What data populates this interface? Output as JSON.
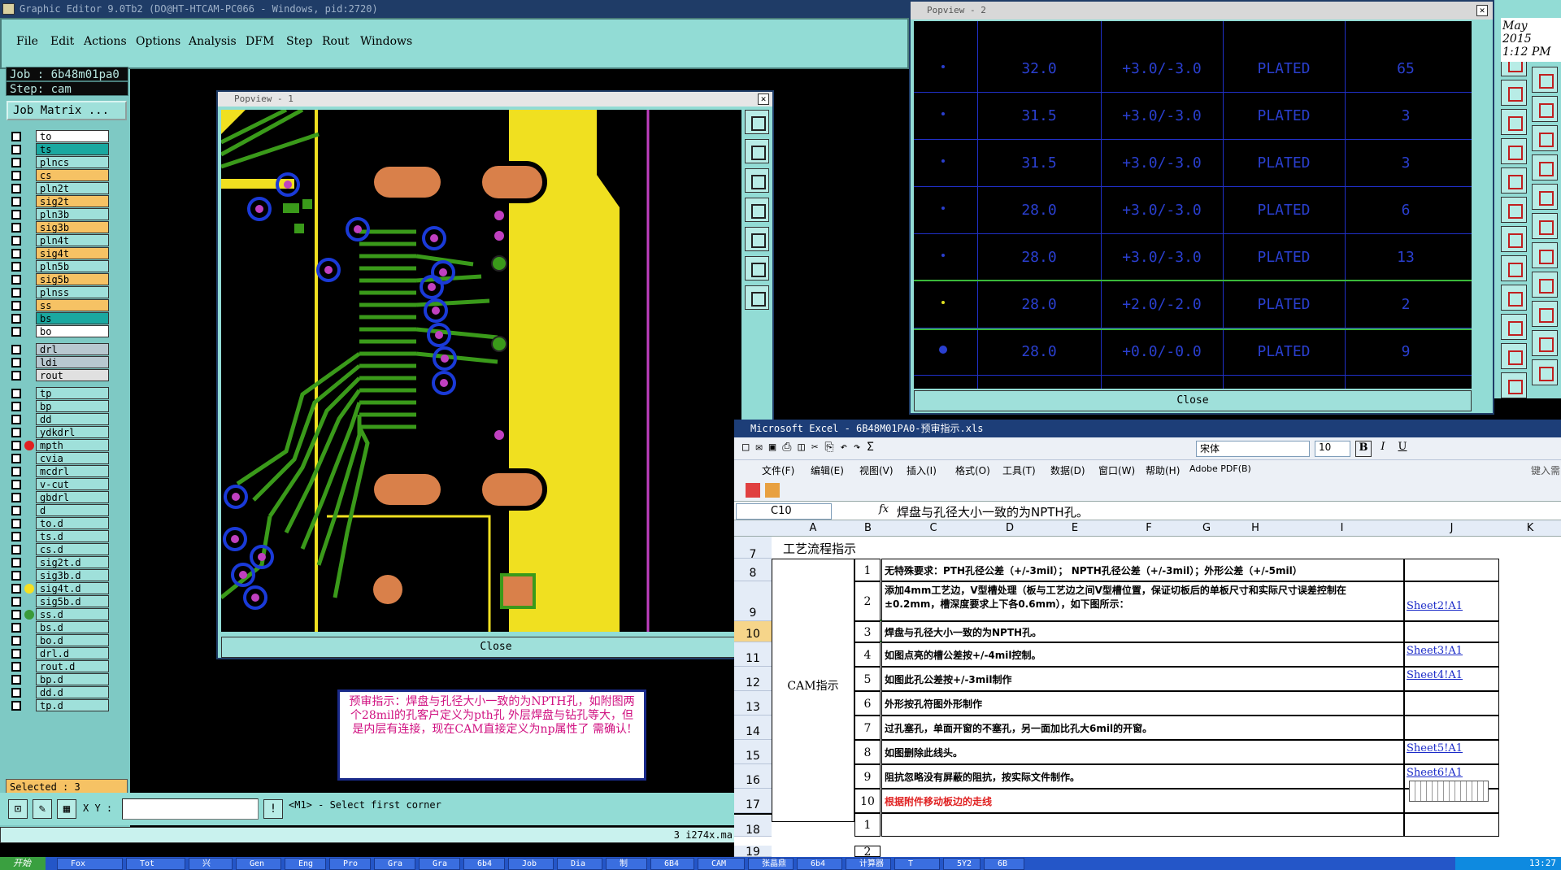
{
  "app": {
    "title": "Graphic Editor 9.0Tb2 (DO@HT-HTCAM-PC066 - Windows, pid:2720)",
    "menu": [
      "File",
      "Edit",
      "Actions",
      "Options",
      "Analysis",
      "DFM",
      "Step",
      "Rout",
      "Windows"
    ]
  },
  "job": {
    "job_label": "Job : 6b48m01pa0",
    "step_label": "Step: cam",
    "matrix_button": "Job Matrix ..."
  },
  "layers": [
    {
      "name": "to",
      "color": "#ffffff"
    },
    {
      "name": "ts",
      "color": "#1aa8a0"
    },
    {
      "name": "plncs",
      "color": "#9fe0da"
    },
    {
      "name": "cs",
      "color": "#f6c264"
    },
    {
      "name": "pln2t",
      "color": "#9fe0da"
    },
    {
      "name": "sig2t",
      "color": "#f6c264"
    },
    {
      "name": "pln3b",
      "color": "#9fe0da"
    },
    {
      "name": "sig3b",
      "color": "#f6c264"
    },
    {
      "name": "pln4t",
      "color": "#9fe0da"
    },
    {
      "name": "sig4t",
      "color": "#f6c264"
    },
    {
      "name": "pln5b",
      "color": "#9fe0da"
    },
    {
      "name": "sig5b",
      "color": "#f6c264"
    },
    {
      "name": "plnss",
      "color": "#9fe0da"
    },
    {
      "name": "ss",
      "color": "#f6c264"
    },
    {
      "name": "bs",
      "color": "#1aa8a0"
    },
    {
      "name": "bo",
      "color": "#ffffff"
    },
    {
      "name": "drl",
      "color": "#b8c8d0"
    },
    {
      "name": "ldi",
      "color": "#b8c8d0"
    },
    {
      "name": "rout",
      "color": "#e0e0e0"
    },
    {
      "name": "tp",
      "color": "#9fe0da"
    },
    {
      "name": "bp",
      "color": "#9fe0da"
    },
    {
      "name": "dd",
      "color": "#9fe0da"
    },
    {
      "name": "ydkdrl",
      "color": "#9fe0da"
    },
    {
      "name": "mpth",
      "color": "#9fe0da",
      "dot": "#e02020"
    },
    {
      "name": "cvia",
      "color": "#9fe0da"
    },
    {
      "name": "mcdrl",
      "color": "#9fe0da"
    },
    {
      "name": "v-cut",
      "color": "#9fe0da"
    },
    {
      "name": "gbdrl",
      "color": "#9fe0da"
    },
    {
      "name": "d",
      "color": "#9fe0da"
    },
    {
      "name": "to.d",
      "color": "#9fe0da"
    },
    {
      "name": "ts.d",
      "color": "#9fe0da"
    },
    {
      "name": "cs.d",
      "color": "#9fe0da"
    },
    {
      "name": "sig2t.d",
      "color": "#9fe0da"
    },
    {
      "name": "sig3b.d",
      "color": "#9fe0da"
    },
    {
      "name": "sig4t.d",
      "color": "#9fe0da",
      "dot": "#f6e020"
    },
    {
      "name": "sig5b.d",
      "color": "#9fe0da"
    },
    {
      "name": "ss.d",
      "color": "#9fe0da",
      "dot": "#3a9a3a"
    },
    {
      "name": "bs.d",
      "color": "#9fe0da"
    },
    {
      "name": "bo.d",
      "color": "#9fe0da"
    },
    {
      "name": "drl.d",
      "color": "#9fe0da"
    },
    {
      "name": "rout.d",
      "color": "#9fe0da"
    },
    {
      "name": "bp.d",
      "color": "#9fe0da"
    },
    {
      "name": "dd.d",
      "color": "#9fe0da"
    },
    {
      "name": "tp.d",
      "color": "#9fe0da"
    }
  ],
  "selected": "Selected : 3",
  "xy_label": "X Y :",
  "prompt": "<M1> - Select first corner",
  "status_right": "3 i274x.ma",
  "popview1": {
    "title": "Popview - 1",
    "close": "Close"
  },
  "popview2": {
    "title": "Popview - 2",
    "close": "Close",
    "rows": [
      {
        "size": "32.0",
        "tol": "+3.0/-3.0",
        "type": "PLATED",
        "count": "65"
      },
      {
        "size": "31.5",
        "tol": "+3.0/-3.0",
        "type": "PLATED",
        "count": "3"
      },
      {
        "size": "31.5",
        "tol": "+3.0/-3.0",
        "type": "PLATED",
        "count": "3"
      },
      {
        "size": "28.0",
        "tol": "+3.0/-3.0",
        "type": "PLATED",
        "count": "6"
      },
      {
        "size": "28.0",
        "tol": "+3.0/-3.0",
        "type": "PLATED",
        "count": "13"
      },
      {
        "size": "28.0",
        "tol": "+2.0/-2.0",
        "type": "PLATED",
        "count": "2"
      },
      {
        "size": "28.0",
        "tol": "+0.0/-0.0",
        "type": "PLATED",
        "count": "9"
      }
    ]
  },
  "clock": {
    "line1": "May 2015",
    "line2": "1:12 PM"
  },
  "precheck": "预审指示：焊盘与孔径大小一致的为NPTH孔，如附图两个28mil的孔客户定义为pth孔 外层焊盘与钻孔等大，但是内层有连接，现在CAM直接定义为np属性了 需确认!",
  "excel": {
    "title": "Microsoft Excel - 6B48M01PA0-预审指示.xls",
    "menu": [
      "文件(F)",
      "编辑(E)",
      "视图(V)",
      "插入(I)",
      "格式(O)",
      "工具(T)",
      "数据(D)",
      "窗口(W)",
      "帮助(H)",
      "Adobe PDF(B)"
    ],
    "font": "宋体",
    "font_size": "10",
    "help_hint": "键入需",
    "namebox": "C10",
    "formula": "焊盘与孔径大小一致的为NPTH孔。",
    "columns": [
      "A",
      "B",
      "C",
      "D",
      "E",
      "F",
      "G",
      "H",
      "I",
      "J",
      "K"
    ],
    "section_title": "工艺流程指示",
    "cam_label": "CAM指示",
    "rows": [
      {
        "rownum": "8",
        "num": "1",
        "text": "无特殊要求：PTH孔径公差（+/-3mil）；  NPTH孔径公差（+/-3mil）；外形公差（+/-5mil）",
        "link": ""
      },
      {
        "rownum": "9",
        "num": "2",
        "text": "添加4mm工艺边，V型槽处理（板与工艺边之间V型槽位置，保证切板后的单板尺寸和实际尺寸误差控制在±0.2mm，槽深度要求上下各0.6mm），如下图所示：",
        "link": "Sheet2!A1"
      },
      {
        "rownum": "10",
        "num": "3",
        "text": "焊盘与孔径大小一致的为NPTH孔。",
        "link": ""
      },
      {
        "rownum": "11",
        "num": "4",
        "text": "如图点亮的槽公差按+/-4mil控制。",
        "link": "Sheet3!A1"
      },
      {
        "rownum": "12",
        "num": "5",
        "text": "如图此孔公差按+/-3mil制作",
        "link": "Sheet4!A1"
      },
      {
        "rownum": "13",
        "num": "6",
        "text": "外形按孔符图外形制作",
        "link": ""
      },
      {
        "rownum": "14",
        "num": "7",
        "text": "过孔塞孔，单面开窗的不塞孔，另一面加比孔大6mil的开窗。",
        "link": ""
      },
      {
        "rownum": "15",
        "num": "8",
        "text": "如图删除此线头。",
        "link": "Sheet5!A1"
      },
      {
        "rownum": "16",
        "num": "9",
        "text": "阻抗忽略没有屏蔽的阻抗，按实际文件制作。",
        "link": "Sheet6!A1"
      },
      {
        "rownum": "17",
        "num": "10",
        "text": "根据附件移动板边的走线",
        "link": ""
      },
      {
        "rownum": "18",
        "num": "1",
        "text": "",
        "link": ""
      }
    ],
    "row7": "7",
    "row19": "19",
    "row19_num": "2"
  },
  "taskbar": {
    "start": "开始",
    "tasks": [
      "Fox",
      "Tot",
      "兴",
      "Gen",
      "Eng",
      "Pro",
      "Gra",
      "Gra",
      "6b4",
      "Job",
      "Dia",
      "制",
      "6B4",
      "CAM",
      "张晶鼎",
      "6b4",
      "计算器",
      "T",
      "5Y2",
      "6B"
    ],
    "time": "13:27"
  }
}
